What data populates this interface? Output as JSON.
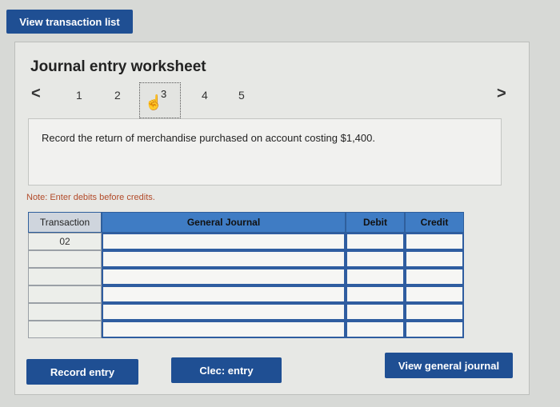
{
  "top": {
    "view_transactions_label": "View transaction list"
  },
  "worksheet": {
    "title": "Journal entry worksheet",
    "prev": "<",
    "next": ">",
    "steps": [
      "1",
      "2",
      "3",
      "4",
      "5"
    ],
    "question": "Record the return of merchandise purchased on account costing $1,400.",
    "note": "Note: Enter debits before credits."
  },
  "table": {
    "headers": {
      "transaction": "Transaction",
      "journal": "General Journal",
      "debit": "Debit",
      "credit": "Credit"
    },
    "rows": [
      {
        "transaction": "02"
      },
      {
        "transaction": ""
      },
      {
        "transaction": ""
      },
      {
        "transaction": ""
      },
      {
        "transaction": ""
      },
      {
        "transaction": ""
      }
    ]
  },
  "buttons": {
    "record": "Record entry",
    "clear": "Clec: entry",
    "view_journal": "View general journal"
  }
}
